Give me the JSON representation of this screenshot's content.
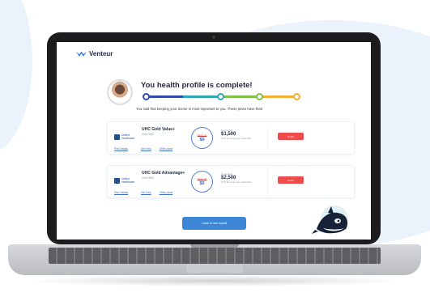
{
  "app": {
    "brand": "Venteur"
  },
  "hero": {
    "title": "You health profile is complete!",
    "subtitle": "You said that keeping your doctor is most important to you. These plans have that!"
  },
  "progress": {
    "colors": [
      "#2f4bb2",
      "#2fa8b8",
      "#7fc14a",
      "#f2b233"
    ]
  },
  "plans": [
    {
      "carrier": "United Healthcare",
      "name": "UHC Gold Value+",
      "type": "Gold HMO",
      "premium_old": "$380.00",
      "premium_new": "$0",
      "deductible_label": "Deductible",
      "deductible": "$1,500",
      "deductible_note": "PCP $0 copay after deductible",
      "enroll_label": "Enroll",
      "links": [
        "Plan Details",
        "Get Help",
        "Other plans"
      ]
    },
    {
      "carrier": "United Healthcare",
      "name": "UHC Gold Advantage+",
      "type": "Gold HMO",
      "premium_old": "$380.00",
      "premium_new": "$0",
      "deductible_label": "Deductible",
      "deductible": "$2,500",
      "deductible_note": "PCP $0 copay after deductible",
      "enroll_label": "Enroll",
      "links": [
        "Plan Details",
        "Get Help",
        "Other plans"
      ]
    }
  ],
  "cta": {
    "label": "I want to see myself"
  },
  "colors": {
    "accent": "#3d86d6",
    "enroll": "#f04b4b",
    "brand": "#1f2a44"
  },
  "icons": [
    "venteur-logo-icon",
    "avatar",
    "mascot-icon",
    "carrier-logo-icon"
  ]
}
